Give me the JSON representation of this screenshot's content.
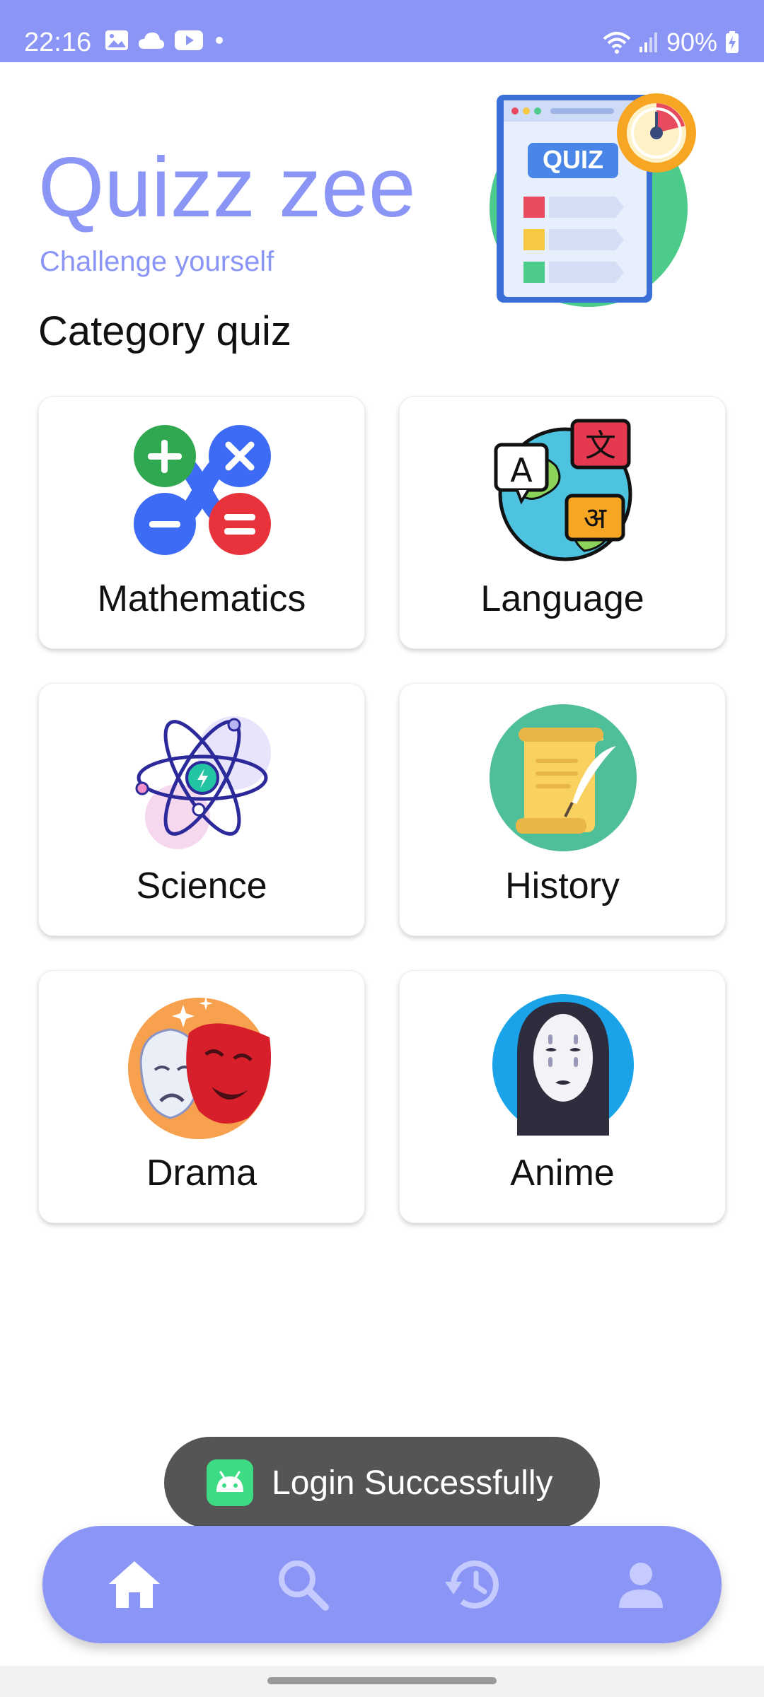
{
  "status_bar": {
    "time": "22:16",
    "battery": "90%",
    "left_icons": [
      "gallery-icon",
      "cloud-icon",
      "youtube-icon",
      "dot-icon"
    ],
    "right_icons": [
      "wifi-icon",
      "signal-icon",
      "battery-charging-icon"
    ]
  },
  "header": {
    "title": "Quizz zee",
    "subtitle": "Challenge yourself",
    "illustration_label": "QUIZ"
  },
  "section_title": "Category quiz",
  "categories": [
    {
      "label": "Mathematics",
      "icon": "math-operators-icon"
    },
    {
      "label": "Language",
      "icon": "language-globe-icon"
    },
    {
      "label": "Science",
      "icon": "atom-icon"
    },
    {
      "label": "History",
      "icon": "scroll-quill-icon"
    },
    {
      "label": "Drama",
      "icon": "theater-masks-icon"
    },
    {
      "label": "Anime",
      "icon": "no-face-icon"
    }
  ],
  "language_icon_glyphs": {
    "a": "A",
    "zh": "文",
    "hi": "अ"
  },
  "toast": {
    "message": "Login Successfully"
  },
  "bottom_nav": {
    "items": [
      {
        "icon": "home-icon",
        "active": true
      },
      {
        "icon": "search-icon",
        "active": false
      },
      {
        "icon": "history-icon",
        "active": false
      },
      {
        "icon": "profile-icon",
        "active": false
      }
    ]
  },
  "colors": {
    "accent": "#8a95f5",
    "toast_bg": "#555555",
    "nav_active": "#ffffff",
    "nav_inactive": "#c5cbff"
  }
}
